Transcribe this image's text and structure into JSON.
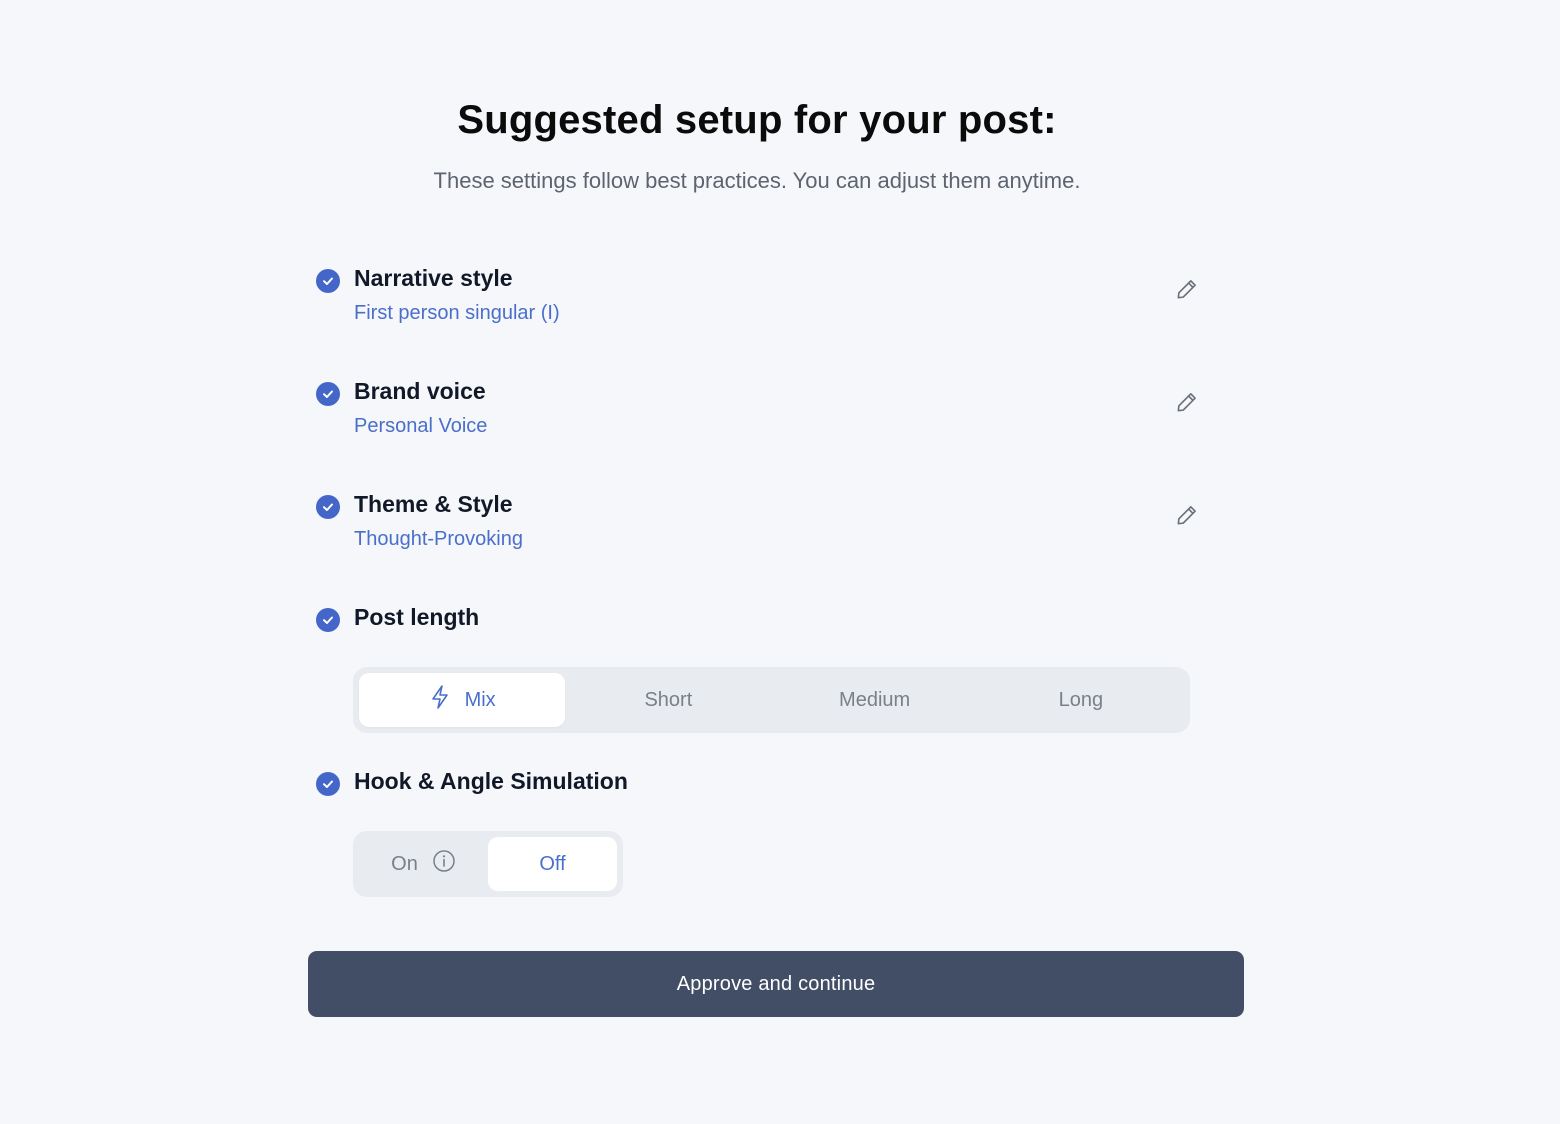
{
  "header": {
    "title": "Suggested setup for your post:",
    "subtitle": "These settings follow best practices. You can adjust them anytime."
  },
  "settings": [
    {
      "label": "Narrative style",
      "value": "First person singular (I)",
      "icon": "pencil-icon"
    },
    {
      "label": "Brand voice",
      "value": "Personal Voice",
      "icon": "pencil-icon"
    },
    {
      "label": "Theme & Style",
      "value": "Thought-Provoking",
      "icon": "pencil-icon"
    }
  ],
  "post_length": {
    "label": "Post length",
    "options": [
      "Mix",
      "Short",
      "Medium",
      "Long"
    ],
    "selected": "Mix",
    "mix_icon": "lightning-icon"
  },
  "hook_simulation": {
    "label": "Hook & Angle Simulation",
    "on_label": "On",
    "off_label": "Off",
    "selected": "Off",
    "info_icon": "info-icon"
  },
  "approve_button": {
    "label": "Approve and continue"
  },
  "colors": {
    "accent": "#4a6fcb",
    "check": "#4466c8",
    "button": "#414e66",
    "background": "#f5f7fa"
  }
}
